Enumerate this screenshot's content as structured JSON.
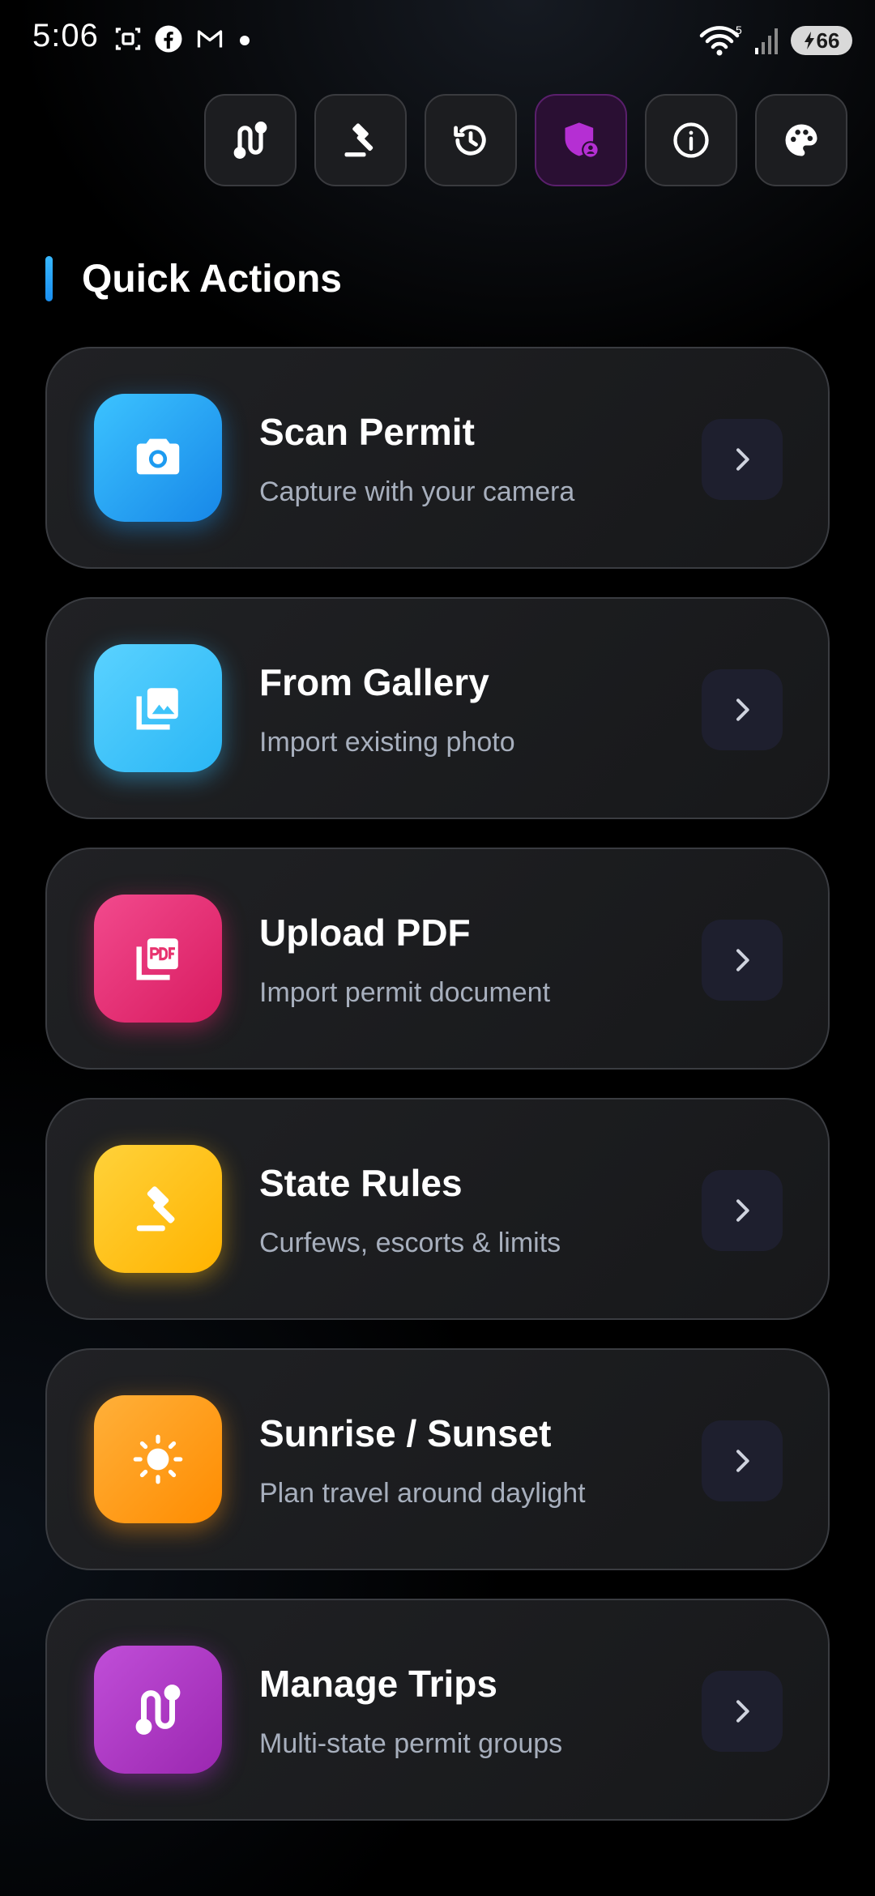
{
  "status_bar": {
    "time": "5:06",
    "notification_icons": [
      "screenshot-icon",
      "facebook-icon",
      "gmail-icon",
      "dot-icon"
    ],
    "wifi_label": "5",
    "battery_level": "66"
  },
  "toolbar": {
    "buttons": [
      {
        "icon": "route-icon",
        "active": false
      },
      {
        "icon": "gavel-icon",
        "active": false
      },
      {
        "icon": "history-icon",
        "active": false
      },
      {
        "icon": "shield-user-icon",
        "active": true
      },
      {
        "icon": "info-icon",
        "active": false
      },
      {
        "icon": "palette-icon",
        "active": false
      }
    ]
  },
  "quick_actions": {
    "heading": "Quick Actions",
    "items": [
      {
        "title": "Scan Permit",
        "subtitle": "Capture with your camera",
        "icon": "camera-icon",
        "color": "#1e9bf0"
      },
      {
        "title": "From Gallery",
        "subtitle": "Import existing photo",
        "icon": "gallery-icon",
        "color": "#3ec4fa"
      },
      {
        "title": "Upload PDF",
        "subtitle": "Import permit document",
        "icon": "pdf-icon",
        "color": "#e8336f"
      },
      {
        "title": "State Rules",
        "subtitle": "Curfews, escorts & limits",
        "icon": "gavel-icon",
        "color": "#ffc21a"
      },
      {
        "title": "Sunrise / Sunset",
        "subtitle": "Plan travel around daylight",
        "icon": "sun-icon",
        "color": "#ff9d14"
      },
      {
        "title": "Manage Trips",
        "subtitle": "Multi-state permit groups",
        "icon": "route-icon",
        "color": "#ad38c4"
      }
    ]
  }
}
